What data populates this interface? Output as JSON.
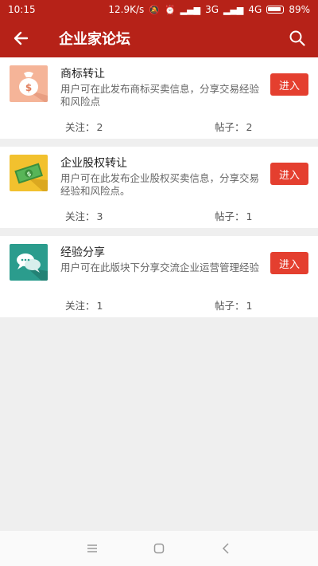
{
  "status": {
    "time": "10:15",
    "speed": "12.9K/s",
    "network": "3G",
    "network2": "4G",
    "battery": "89%"
  },
  "appbar": {
    "title": "企业家论坛",
    "back_icon": "back-arrow-icon",
    "search_icon": "search-icon"
  },
  "forums": [
    {
      "name": "商标转让",
      "desc": "用户可在此发布商标买卖信息，分享交易经验和风险点",
      "follow_label": "关注：",
      "follow": "2",
      "posts_label": "帖子：",
      "posts": "2",
      "enter": "进入",
      "icon": "money-bag-icon",
      "icon_color": "#f5b498"
    },
    {
      "name": "企业股权转让",
      "desc": "用户可在此发布企业股权买卖信息，分享交易经验和风险点。",
      "follow_label": "关注：",
      "follow": "3",
      "posts_label": "帖子：",
      "posts": "1",
      "enter": "进入",
      "icon": "banknote-icon",
      "icon_color": "#f2c12e"
    },
    {
      "name": "经验分享",
      "desc": "用户可在此版块下分享交流企业运营管理经验",
      "follow_label": "关注：",
      "follow": "1",
      "posts_label": "帖子：",
      "posts": "1",
      "enter": "进入",
      "icon": "chat-bubbles-icon",
      "icon_color": "#2b9c8d"
    }
  ],
  "navbar": {
    "menu_icon": "menu-icon",
    "home_icon": "home-icon",
    "back_icon": "nav-back-icon"
  }
}
